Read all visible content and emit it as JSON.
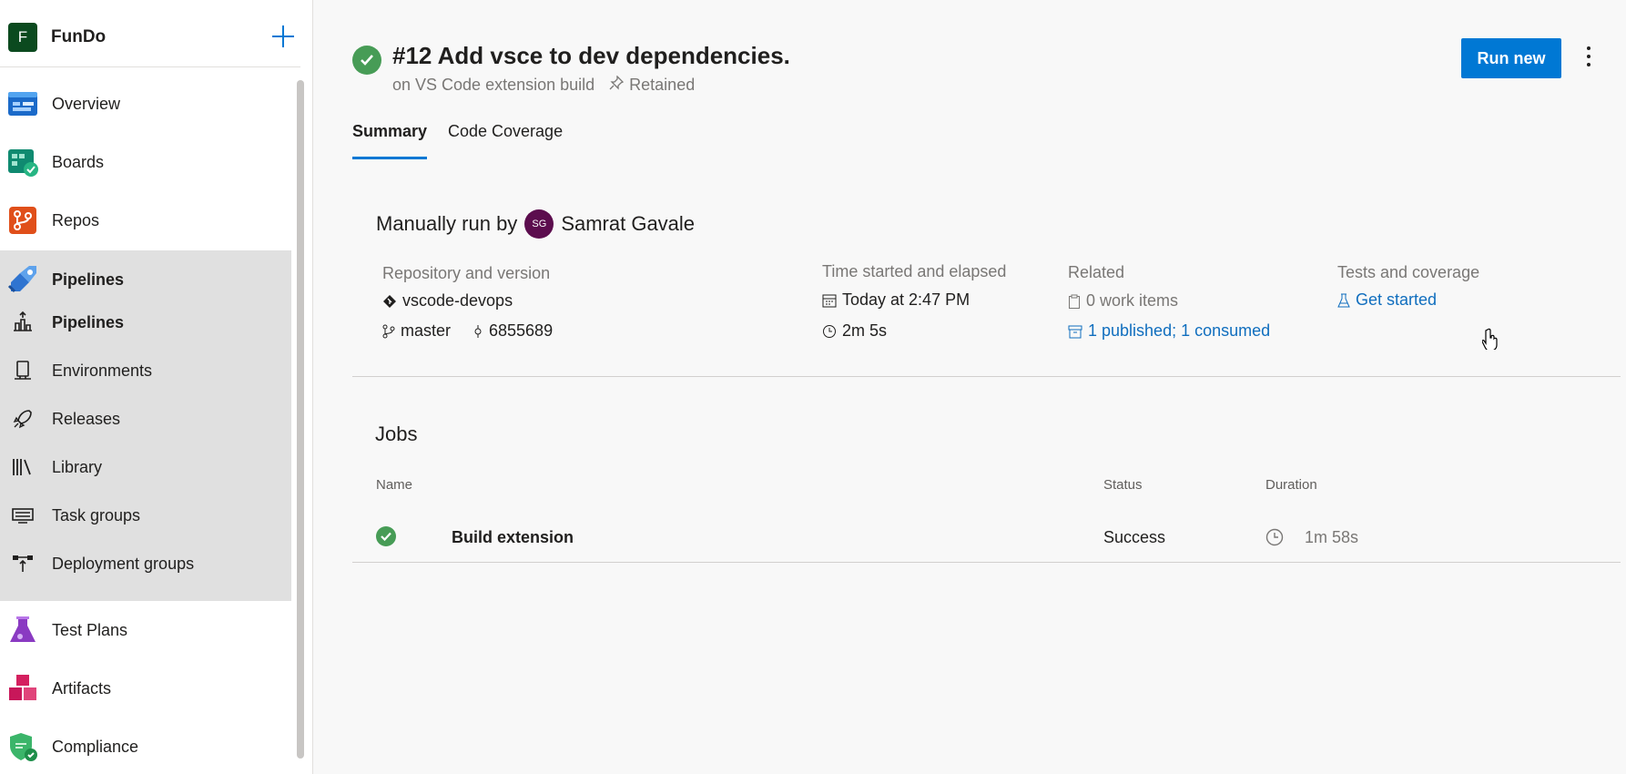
{
  "sidebar": {
    "org_initial": "F",
    "org_name": "FunDo",
    "add_label": "+",
    "items": [
      {
        "label": "Overview",
        "icon": "overview-icon"
      },
      {
        "label": "Boards",
        "icon": "boards-icon"
      },
      {
        "label": "Repos",
        "icon": "repos-icon"
      },
      {
        "label": "Pipelines",
        "icon": "pipelines-icon"
      },
      {
        "label": "Test Plans",
        "icon": "test-plans-icon"
      },
      {
        "label": "Artifacts",
        "icon": "artifacts-icon"
      },
      {
        "label": "Compliance",
        "icon": "compliance-icon"
      }
    ],
    "sub_items": [
      {
        "label": "Pipelines",
        "icon": "pipelines-sub-icon"
      },
      {
        "label": "Environments",
        "icon": "environments-icon"
      },
      {
        "label": "Releases",
        "icon": "releases-icon"
      },
      {
        "label": "Library",
        "icon": "library-icon"
      },
      {
        "label": "Task groups",
        "icon": "task-groups-icon"
      },
      {
        "label": "Deployment groups",
        "icon": "deployment-groups-icon"
      }
    ]
  },
  "header": {
    "title": "#12 Add vsce to dev dependencies.",
    "pipeline": "on VS Code extension build",
    "retained": "Retained",
    "run_new": "Run new"
  },
  "tabs": [
    "Summary",
    "Code Coverage"
  ],
  "summary": {
    "manually_run_by": "Manually run by",
    "avatar_initials": "SG",
    "user": "Samrat Gavale",
    "repo_header": "Repository and version",
    "repo": "vscode-devops",
    "branch": "master",
    "commit": "6855689",
    "time_header": "Time started and elapsed",
    "started": "Today at 2:47 PM",
    "elapsed": "2m 5s",
    "related_header": "Related",
    "work_items": "0 work items",
    "artifacts": "1 published; 1 consumed",
    "tests_header": "Tests and coverage",
    "get_started": "Get started"
  },
  "jobs": {
    "title": "Jobs",
    "columns": [
      "Name",
      "Status",
      "Duration"
    ],
    "rows": [
      {
        "name": "Build extension",
        "status": "Success",
        "duration": "1m 58s"
      }
    ]
  },
  "colors": {
    "accent": "#0078d4",
    "success": "#479c56",
    "link": "#106ebe",
    "org_badge": "#0b4a1f",
    "avatar": "#5c0d4e"
  }
}
